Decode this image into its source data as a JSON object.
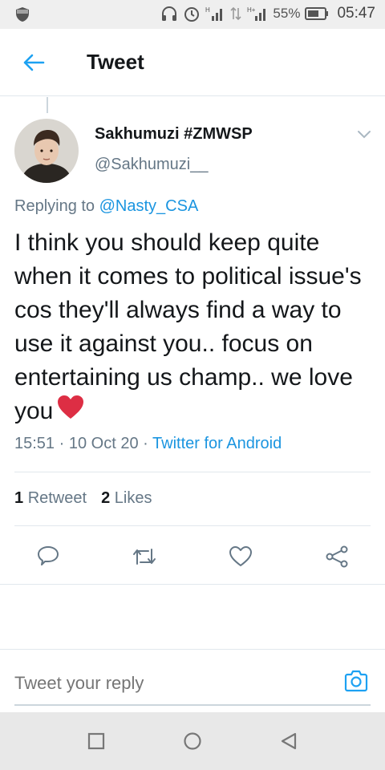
{
  "status_bar": {
    "battery_percent": "55%",
    "time": "05:47",
    "network_label": "H+",
    "icons": [
      "shield-icon",
      "headphones-icon",
      "alarm-icon",
      "signal-icon",
      "data-arrows-icon",
      "signal-h-plus-icon",
      "battery-icon"
    ]
  },
  "header": {
    "title": "Tweet",
    "back_icon": "arrow-left-icon"
  },
  "tweet": {
    "display_name": "Sakhumuzi #ZMWSP",
    "handle": "@Sakhumuzi__",
    "replying_prefix": "Replying to",
    "replying_to": "@Nasty_CSA",
    "text": "I think you should keep quite when it comes to political issue's cos they'll always find a way to use it against you.. focus on entertaining us champ.. we love you",
    "emoji": "heart-emoji",
    "time": "15:51",
    "date": "10 Oct 20",
    "separator": "·",
    "source": "Twitter for Android"
  },
  "stats": {
    "retweets_count": "1",
    "retweets_label": "Retweet",
    "likes_count": "2",
    "likes_label": "Likes"
  },
  "actions": [
    "reply-icon",
    "retweet-icon",
    "like-icon",
    "share-icon"
  ],
  "reply": {
    "placeholder": "Tweet your reply",
    "camera_icon": "camera-icon"
  },
  "nav": [
    "recents-icon",
    "home-icon",
    "back-icon"
  ],
  "colors": {
    "accent": "#1da1f2",
    "link": "#1b95e0",
    "text_primary": "#14171a",
    "text_secondary": "#657786",
    "heart": "#e0245e",
    "divider": "#e1e8ed"
  }
}
